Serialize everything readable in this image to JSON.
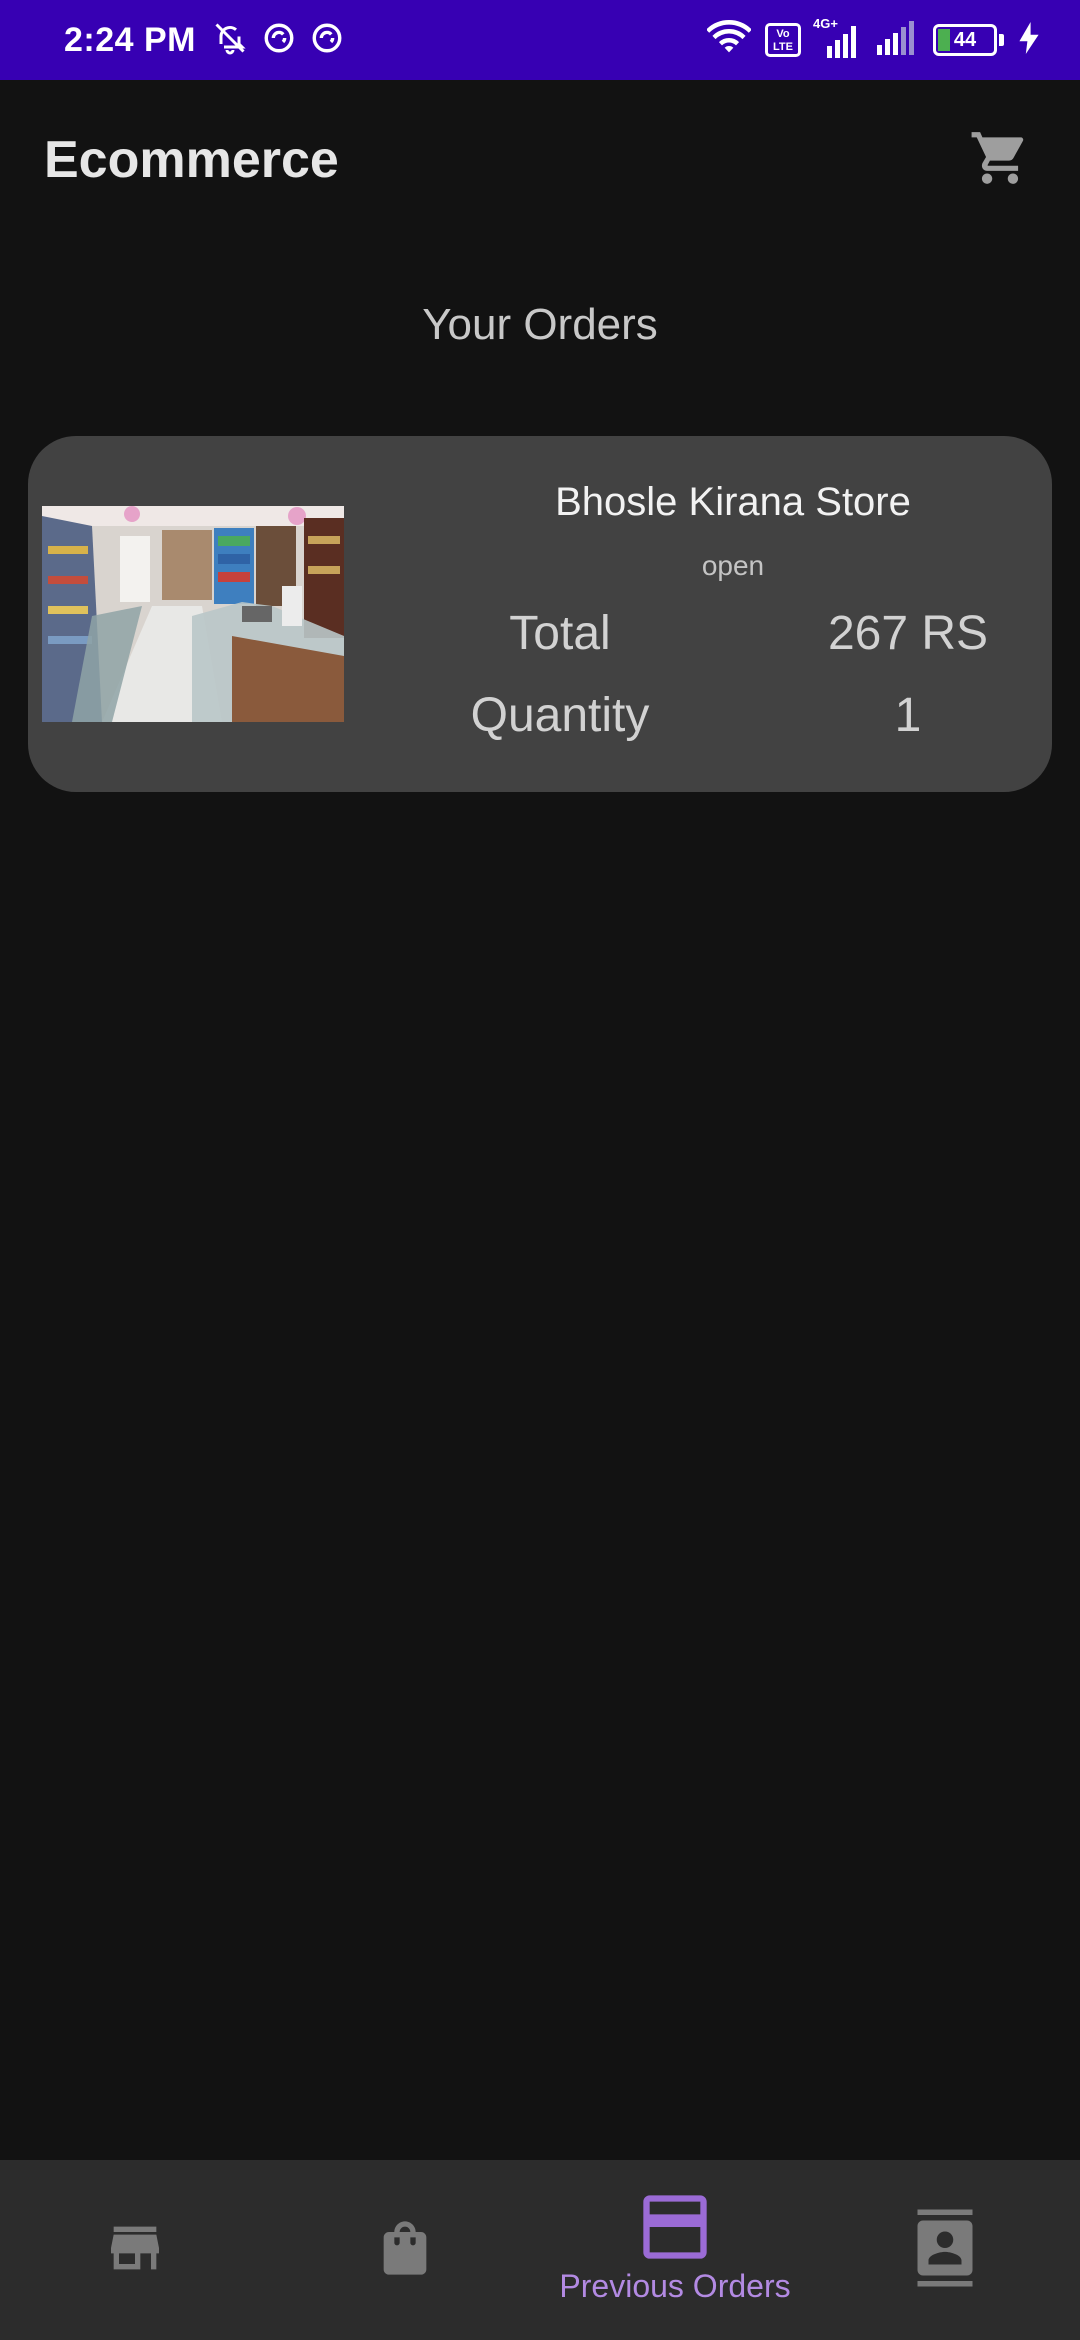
{
  "status_bar": {
    "time": "2:24 PM",
    "battery": "44",
    "network": "4G+",
    "volte": "Vo LTE",
    "icons": [
      "mute-icon",
      "data-saver-icon",
      "data-saver-icon",
      "wifi-icon",
      "volte-icon",
      "signal-icon",
      "signal-icon",
      "battery-icon",
      "charging-icon"
    ]
  },
  "app_bar": {
    "title": "Ecommerce",
    "cart_icon": "cart-icon"
  },
  "page": {
    "title": "Your Orders"
  },
  "orders": [
    {
      "store_name": "Bhosle Kirana Store",
      "status": "open",
      "total_label": "Total",
      "total_value": "267 RS",
      "quantity_label": "Quantity",
      "quantity_value": "1",
      "image": "store-photo"
    }
  ],
  "bottom_nav": {
    "items": [
      {
        "icon": "store-icon",
        "label": ""
      },
      {
        "icon": "shopping-bag-icon",
        "label": ""
      },
      {
        "icon": "credit-card-icon",
        "label": "Previous Orders",
        "active": true
      },
      {
        "icon": "contact-card-icon",
        "label": ""
      }
    ],
    "active_color": "#9b6bd6",
    "inactive_color": "#7a7a7a"
  },
  "colors": {
    "status_bar": "#3700b3",
    "background": "#121212",
    "card": "#424242",
    "nav": "#2c2c2c"
  }
}
